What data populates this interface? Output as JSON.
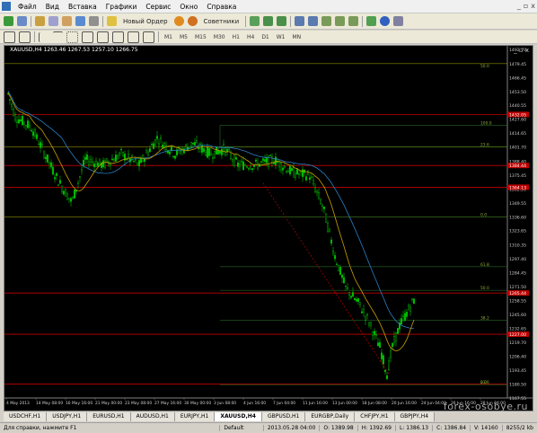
{
  "menu": {
    "items": [
      "Файл",
      "Вид",
      "Вставка",
      "Графики",
      "Сервис",
      "Окно",
      "Справка"
    ],
    "window_controls": [
      "_",
      "▫",
      "x"
    ]
  },
  "toolbar1": {
    "new_order": "Новый Ордер",
    "advisors": "Советники"
  },
  "toolbar2": {
    "timeframes": [
      "M1",
      "M5",
      "M15",
      "M30",
      "H1",
      "H4",
      "D1",
      "W1",
      "MN"
    ]
  },
  "chart": {
    "title": "XAUUSD,H4  1263.46  1267.53  1257.10  1266.75",
    "window_buttons": "_ ▫ x",
    "price_labels": [
      "1492.70",
      "1479.45",
      "1466.45",
      "1453.50",
      "1440.55",
      "1427.60",
      "1414.65",
      "1401.70",
      "1388.40",
      "1375.45",
      "1362.50",
      "1349.55",
      "1336.60",
      "1323.65",
      "1310.35",
      "1297.40",
      "1284.45",
      "1271.50",
      "1258.55",
      "1245.60",
      "1232.65",
      "1219.70",
      "1206.40",
      "1193.45",
      "1180.50",
      "1167.55"
    ],
    "highlight_labels": [
      "1432.05",
      "1384.44",
      "1364.13",
      "1265.44",
      "1227.00"
    ],
    "fib_labels": [
      "50.0",
      "100.0",
      "23.6",
      "0.0",
      "61.8",
      "50.0",
      "38.2",
      "23.6",
      "0.0"
    ],
    "time_labels": [
      "4 May 2013",
      "14 May 08:00",
      "16 May 16:00",
      "21 May 00:00",
      "23 May 08:00",
      "27 May 16:00",
      "30 May 00:00",
      "3 Jun 08:00",
      "4 Jun 16:00",
      "7 Jun 04:00",
      "11 Jun 16:00",
      "13 Jun 00:00",
      "18 Jun 08:00",
      "20 Jun 16:00",
      "24 Jun 04:00",
      "26 Jun 16:00",
      "28 Jun 04:00"
    ]
  },
  "tabs": [
    "USDCHF,H1",
    "USDJPY,H1",
    "EURUSD,H1",
    "AUDUSD,H1",
    "EURJPY,H1",
    "XAUUSD,H4",
    "GBPUSD,H1",
    "EURGBP,Daily",
    "CHFJPY,H1",
    "GBPJPY,H4"
  ],
  "status": {
    "help": "Для справки, нажмите F1",
    "profile": "Default",
    "datetime": "2013.05.28 04:00",
    "open": "O: 1389.98",
    "high": "H: 1392.69",
    "low": "L: 1386.13",
    "close": "C: 1386.84",
    "volume": "V: 14160",
    "traffic": "8255/2 kb"
  },
  "watermark": "forex-osobye.ru",
  "colors": {
    "background": "#000000",
    "candle": "#00c000",
    "level_red": "#c00000",
    "level_yellow": "#c8c800",
    "ma_blue": "#2a80c8",
    "ma_yellow": "#c8a000",
    "trend_red": "#c00000"
  }
}
